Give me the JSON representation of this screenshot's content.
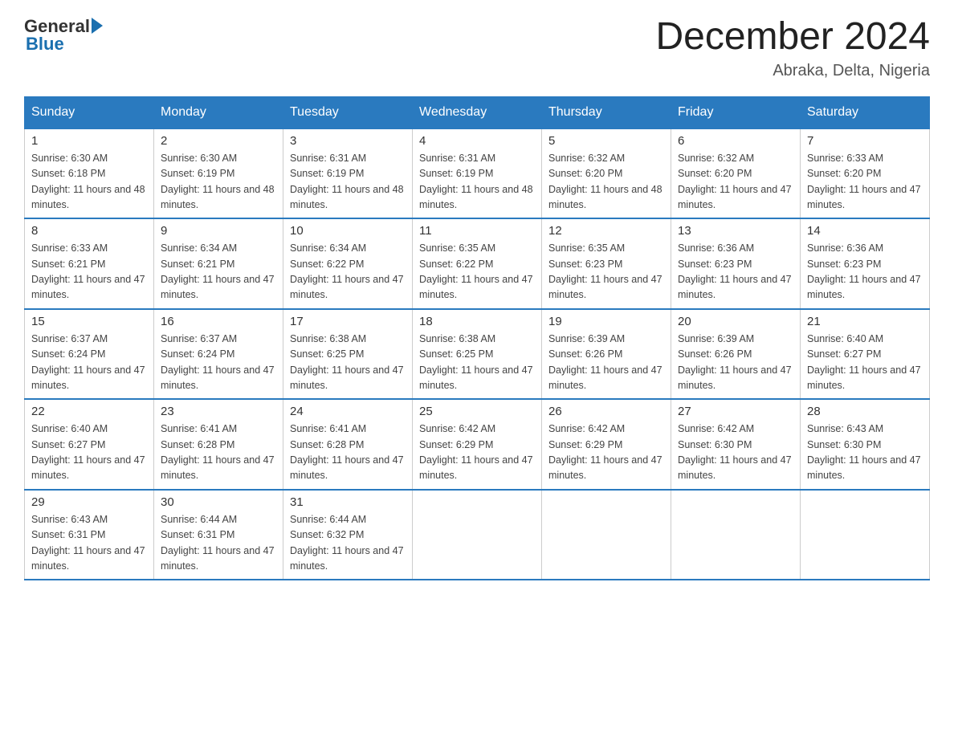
{
  "header": {
    "logo_general": "General",
    "logo_blue": "Blue",
    "month_year": "December 2024",
    "location": "Abraka, Delta, Nigeria"
  },
  "days_of_week": [
    "Sunday",
    "Monday",
    "Tuesday",
    "Wednesday",
    "Thursday",
    "Friday",
    "Saturday"
  ],
  "weeks": [
    [
      {
        "day": "1",
        "sunrise": "6:30 AM",
        "sunset": "6:18 PM",
        "daylight": "11 hours and 48 minutes."
      },
      {
        "day": "2",
        "sunrise": "6:30 AM",
        "sunset": "6:19 PM",
        "daylight": "11 hours and 48 minutes."
      },
      {
        "day": "3",
        "sunrise": "6:31 AM",
        "sunset": "6:19 PM",
        "daylight": "11 hours and 48 minutes."
      },
      {
        "day": "4",
        "sunrise": "6:31 AM",
        "sunset": "6:19 PM",
        "daylight": "11 hours and 48 minutes."
      },
      {
        "day": "5",
        "sunrise": "6:32 AM",
        "sunset": "6:20 PM",
        "daylight": "11 hours and 48 minutes."
      },
      {
        "day": "6",
        "sunrise": "6:32 AM",
        "sunset": "6:20 PM",
        "daylight": "11 hours and 47 minutes."
      },
      {
        "day": "7",
        "sunrise": "6:33 AM",
        "sunset": "6:20 PM",
        "daylight": "11 hours and 47 minutes."
      }
    ],
    [
      {
        "day": "8",
        "sunrise": "6:33 AM",
        "sunset": "6:21 PM",
        "daylight": "11 hours and 47 minutes."
      },
      {
        "day": "9",
        "sunrise": "6:34 AM",
        "sunset": "6:21 PM",
        "daylight": "11 hours and 47 minutes."
      },
      {
        "day": "10",
        "sunrise": "6:34 AM",
        "sunset": "6:22 PM",
        "daylight": "11 hours and 47 minutes."
      },
      {
        "day": "11",
        "sunrise": "6:35 AM",
        "sunset": "6:22 PM",
        "daylight": "11 hours and 47 minutes."
      },
      {
        "day": "12",
        "sunrise": "6:35 AM",
        "sunset": "6:23 PM",
        "daylight": "11 hours and 47 minutes."
      },
      {
        "day": "13",
        "sunrise": "6:36 AM",
        "sunset": "6:23 PM",
        "daylight": "11 hours and 47 minutes."
      },
      {
        "day": "14",
        "sunrise": "6:36 AM",
        "sunset": "6:23 PM",
        "daylight": "11 hours and 47 minutes."
      }
    ],
    [
      {
        "day": "15",
        "sunrise": "6:37 AM",
        "sunset": "6:24 PM",
        "daylight": "11 hours and 47 minutes."
      },
      {
        "day": "16",
        "sunrise": "6:37 AM",
        "sunset": "6:24 PM",
        "daylight": "11 hours and 47 minutes."
      },
      {
        "day": "17",
        "sunrise": "6:38 AM",
        "sunset": "6:25 PM",
        "daylight": "11 hours and 47 minutes."
      },
      {
        "day": "18",
        "sunrise": "6:38 AM",
        "sunset": "6:25 PM",
        "daylight": "11 hours and 47 minutes."
      },
      {
        "day": "19",
        "sunrise": "6:39 AM",
        "sunset": "6:26 PM",
        "daylight": "11 hours and 47 minutes."
      },
      {
        "day": "20",
        "sunrise": "6:39 AM",
        "sunset": "6:26 PM",
        "daylight": "11 hours and 47 minutes."
      },
      {
        "day": "21",
        "sunrise": "6:40 AM",
        "sunset": "6:27 PM",
        "daylight": "11 hours and 47 minutes."
      }
    ],
    [
      {
        "day": "22",
        "sunrise": "6:40 AM",
        "sunset": "6:27 PM",
        "daylight": "11 hours and 47 minutes."
      },
      {
        "day": "23",
        "sunrise": "6:41 AM",
        "sunset": "6:28 PM",
        "daylight": "11 hours and 47 minutes."
      },
      {
        "day": "24",
        "sunrise": "6:41 AM",
        "sunset": "6:28 PM",
        "daylight": "11 hours and 47 minutes."
      },
      {
        "day": "25",
        "sunrise": "6:42 AM",
        "sunset": "6:29 PM",
        "daylight": "11 hours and 47 minutes."
      },
      {
        "day": "26",
        "sunrise": "6:42 AM",
        "sunset": "6:29 PM",
        "daylight": "11 hours and 47 minutes."
      },
      {
        "day": "27",
        "sunrise": "6:42 AM",
        "sunset": "6:30 PM",
        "daylight": "11 hours and 47 minutes."
      },
      {
        "day": "28",
        "sunrise": "6:43 AM",
        "sunset": "6:30 PM",
        "daylight": "11 hours and 47 minutes."
      }
    ],
    [
      {
        "day": "29",
        "sunrise": "6:43 AM",
        "sunset": "6:31 PM",
        "daylight": "11 hours and 47 minutes."
      },
      {
        "day": "30",
        "sunrise": "6:44 AM",
        "sunset": "6:31 PM",
        "daylight": "11 hours and 47 minutes."
      },
      {
        "day": "31",
        "sunrise": "6:44 AM",
        "sunset": "6:32 PM",
        "daylight": "11 hours and 47 minutes."
      },
      null,
      null,
      null,
      null
    ]
  ]
}
